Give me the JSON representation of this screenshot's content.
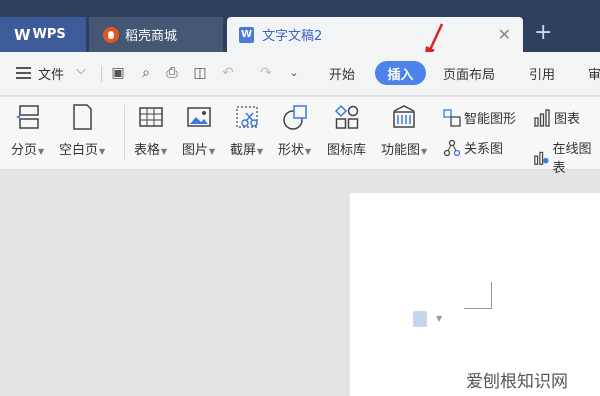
{
  "tabs": {
    "wps": {
      "label": "WPS",
      "logo": "W"
    },
    "shop": {
      "label": "稻壳商城"
    },
    "doc": {
      "label": "文字文稿2",
      "icon_letter": "W"
    }
  },
  "menu": {
    "file": "文件",
    "items": [
      "开始",
      "插入",
      "页面布局",
      "引用",
      "审"
    ],
    "active": "插入"
  },
  "ribbon": {
    "page_break": "分页",
    "blank_page": "空白页",
    "table": "表格",
    "picture": "图片",
    "screenshot": "截屏",
    "shape": "形状",
    "icon_lib": "图标库",
    "function_chart": "功能图",
    "smart_art": "智能图形",
    "chart": "图表",
    "relation": "关系图",
    "online_chart": "在线图表"
  },
  "watermark": "爱刨根知识网",
  "colors": {
    "accent": "#4b83e8",
    "tabbar": "#2e3f5f",
    "arrow": "#e02020"
  }
}
